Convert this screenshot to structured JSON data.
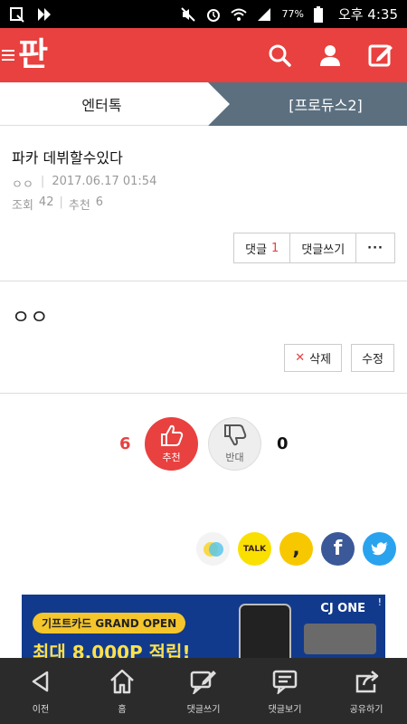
{
  "status_bar": {
    "battery": "77%",
    "time": "오후 4:35"
  },
  "header": {
    "logo": "판",
    "icons": [
      "search-icon",
      "user-icon",
      "write-icon"
    ]
  },
  "tabs": {
    "left": "엔터톡",
    "right": "[프로듀스2]"
  },
  "post": {
    "title": "파카 데뷔할수있다",
    "author": "ㅇㅇ",
    "date": "2017.06.17 01:54",
    "views_label": "조회",
    "views": "42",
    "recommend_label": "추천",
    "recommend": "6",
    "reply_label": "댓글",
    "reply_count": "1",
    "write_reply": "댓글쓰기",
    "more": "···"
  },
  "body": {
    "text": "ㅇㅇ",
    "delete": "삭제",
    "edit": "수정"
  },
  "vote": {
    "up_count": "6",
    "up_label": "추천",
    "down_count": "0",
    "down_label": "반대",
    "up_color": "#e8413f"
  },
  "share": {
    "icons": [
      "kakaostory-icon",
      "kakaotalk-icon",
      "comma-icon",
      "facebook-icon",
      "twitter-icon"
    ],
    "talk_label": "TALK"
  },
  "ad": {
    "pill": "기프트카드 GRAND OPEN",
    "main": "최대 8,000P 적립!",
    "brand": "CJ ONE"
  },
  "bottom_nav": {
    "items": [
      {
        "label": "이전",
        "icon": "back-icon"
      },
      {
        "label": "홈",
        "icon": "home-icon"
      },
      {
        "label": "댓글쓰기",
        "icon": "write-reply-icon"
      },
      {
        "label": "댓글보기",
        "icon": "view-replies-icon"
      },
      {
        "label": "공유하기",
        "icon": "share-icon"
      }
    ]
  },
  "colors": {
    "brand": "#e8413f",
    "tab_active": "#5b6f7f",
    "nav_bg": "#2b2b2b"
  }
}
